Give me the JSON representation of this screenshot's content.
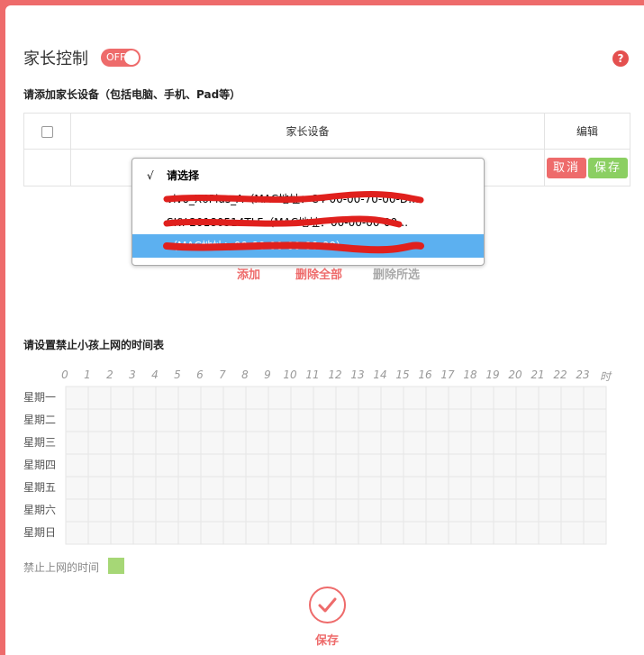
{
  "header": {
    "title": "家长控制",
    "toggle_text": "OFF",
    "help_symbol": "?"
  },
  "devices_section": {
    "heading": "请添加家长设备（包括电脑、手机、Pad等）",
    "table": {
      "col_device": "家长设备",
      "col_edit": "编辑"
    },
    "cancel_label": "取消",
    "save_label": "保存",
    "dropdown": {
      "check_mark": "√",
      "options": [
        "请选择",
        "vivo_X6Plus_A（MAC地址：C4-00-00-70-00-D…",
        "SKY-20180514TLF（MAC地址：00-00-00-00…",
        "（MAC地址：00-00-00-00-00-00）"
      ],
      "selected_index": 3,
      "checked_index": 0
    },
    "actions": {
      "add": "添加",
      "delete_all": "删除全部",
      "delete_selected": "删除所选"
    }
  },
  "schedule_section": {
    "heading": "请设置禁止小孩上网的时间表",
    "hours": [
      "0",
      "1",
      "2",
      "3",
      "4",
      "5",
      "6",
      "7",
      "8",
      "9",
      "10",
      "11",
      "12",
      "13",
      "14",
      "15",
      "16",
      "17",
      "18",
      "19",
      "20",
      "21",
      "22",
      "23"
    ],
    "hour_unit": "时",
    "days": [
      "星期一",
      "星期二",
      "星期三",
      "星期四",
      "星期五",
      "星期六",
      "星期日"
    ],
    "legend_label": "禁止上网的时间"
  },
  "footer": {
    "save_label": "保存"
  },
  "colors": {
    "accent": "#ee6b6b",
    "save_green": "#8bcf62",
    "legend_green": "#a6d776",
    "selected_blue": "#5cb0f0"
  }
}
